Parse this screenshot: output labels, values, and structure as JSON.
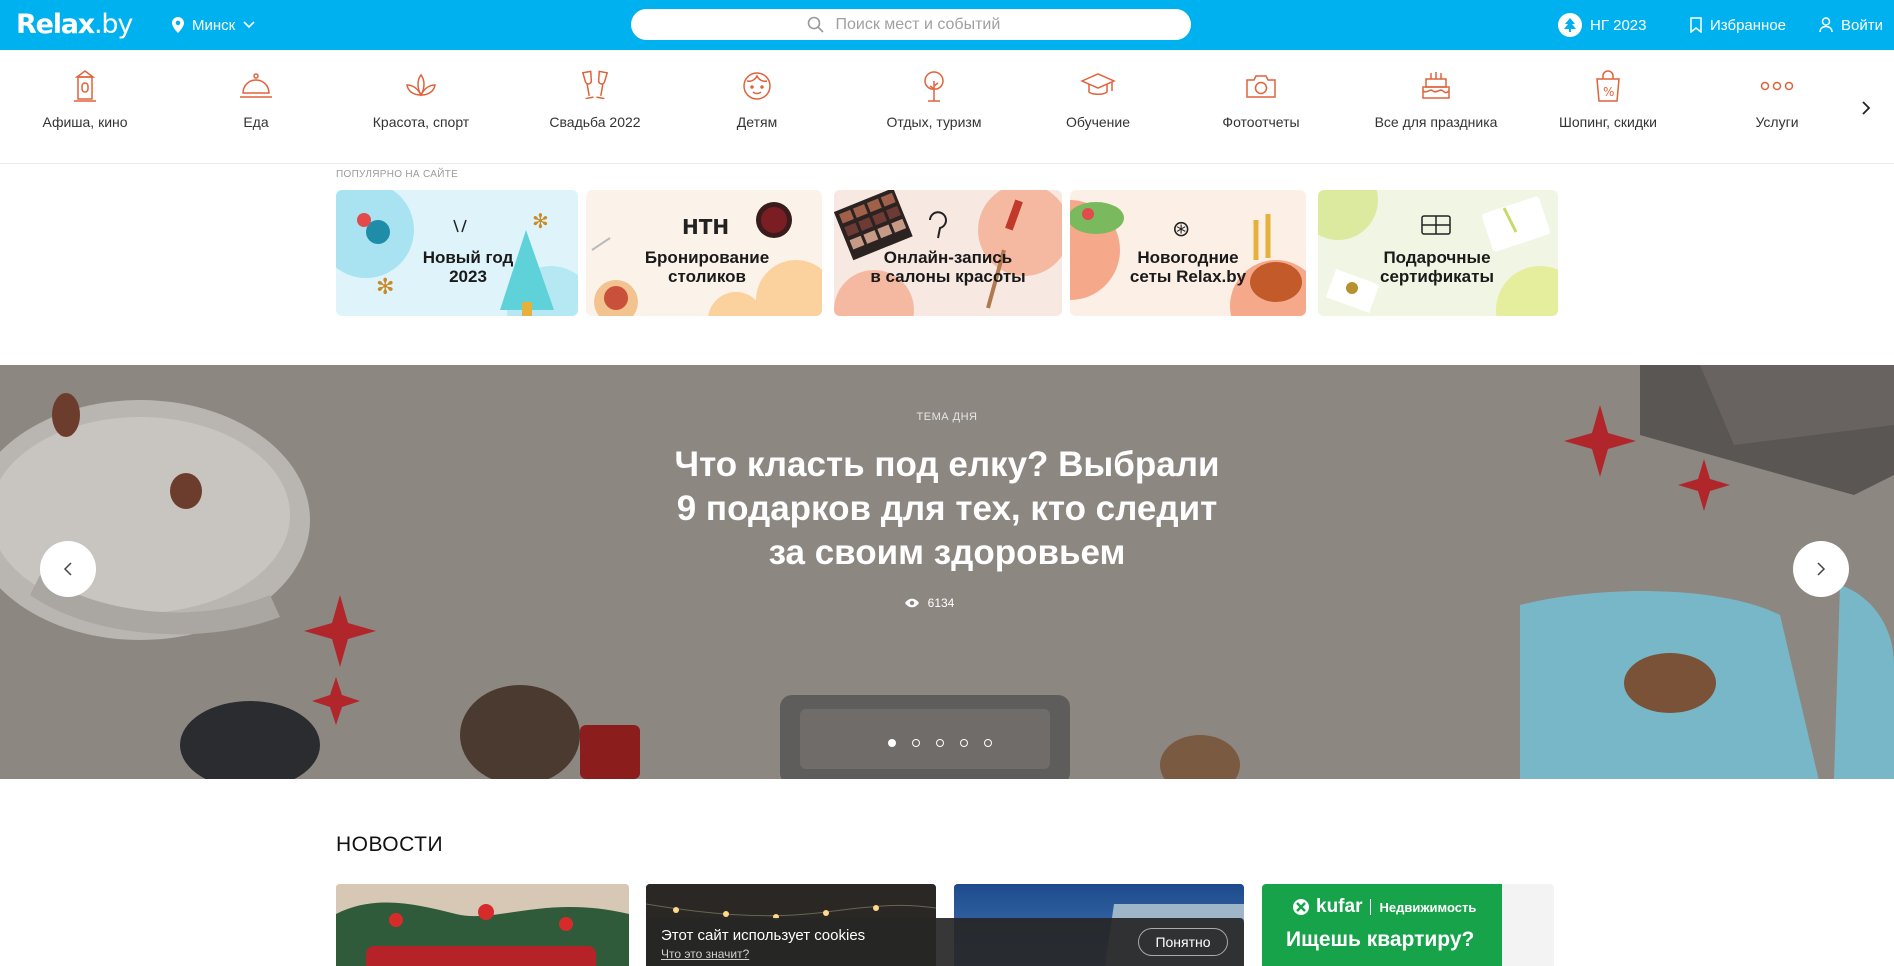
{
  "header": {
    "logo_main": "Relax",
    "logo_suffix": ".by",
    "city": "Минск",
    "search_placeholder": "Поиск мест и событий",
    "ng_label": "НГ 2023",
    "favorites_label": "Избранное",
    "login_label": "Войти",
    "colors": {
      "bar": "#00b1ef",
      "text": "#ffffff"
    }
  },
  "categories": [
    {
      "label": "Афиша, кино",
      "icon": "theater-icon"
    },
    {
      "label": "Еда",
      "icon": "cloche-icon"
    },
    {
      "label": "Красота, спорт",
      "icon": "lotus-icon"
    },
    {
      "label": "Свадьба 2022",
      "icon": "champagne-glasses-icon"
    },
    {
      "label": "Детям",
      "icon": "child-face-icon"
    },
    {
      "label": "Отдых, туризм",
      "icon": "tree-icon"
    },
    {
      "label": "Обучение",
      "icon": "graduation-cap-icon"
    },
    {
      "label": "Фотоотчеты",
      "icon": "camera-icon"
    },
    {
      "label": "Все для праздника",
      "icon": "cake-icon"
    },
    {
      "label": "Шопинг, скидки",
      "icon": "shopping-bag-icon"
    },
    {
      "label": "Услуги",
      "icon": "more-dots-icon"
    }
  ],
  "category_icon_color": "#e0623a",
  "popular": {
    "label": "ПОПУЛЯРНО НА САЙТЕ",
    "items": [
      {
        "title_line1": "Новый год",
        "title_line2": "2023"
      },
      {
        "title_line1": "Бронирование",
        "title_line2": "столиков"
      },
      {
        "title_line1": "Онлайн-запись",
        "title_line2": "в салоны красоты"
      },
      {
        "title_line1": "Новогодние",
        "title_line2": "сеты Relax.by"
      },
      {
        "title_line1": "Подарочные",
        "title_line2": "сертификаты"
      }
    ]
  },
  "hero": {
    "kicker": "ТЕМА ДНЯ",
    "title": "Что класть под елку? Выбрали 9 подарков для тех, кто следит за своим здоровьем",
    "views": "6134",
    "slides_total": 5,
    "active_slide": 1
  },
  "news": {
    "title": "НОВОСТИ",
    "ad_brand": "kufar",
    "ad_category": "Недвижимость",
    "ad_headline": "Ищешь квартиру?"
  },
  "cookie": {
    "text": "Этот сайт использует cookies",
    "link": "Что это значит?",
    "button": "Понятно"
  }
}
